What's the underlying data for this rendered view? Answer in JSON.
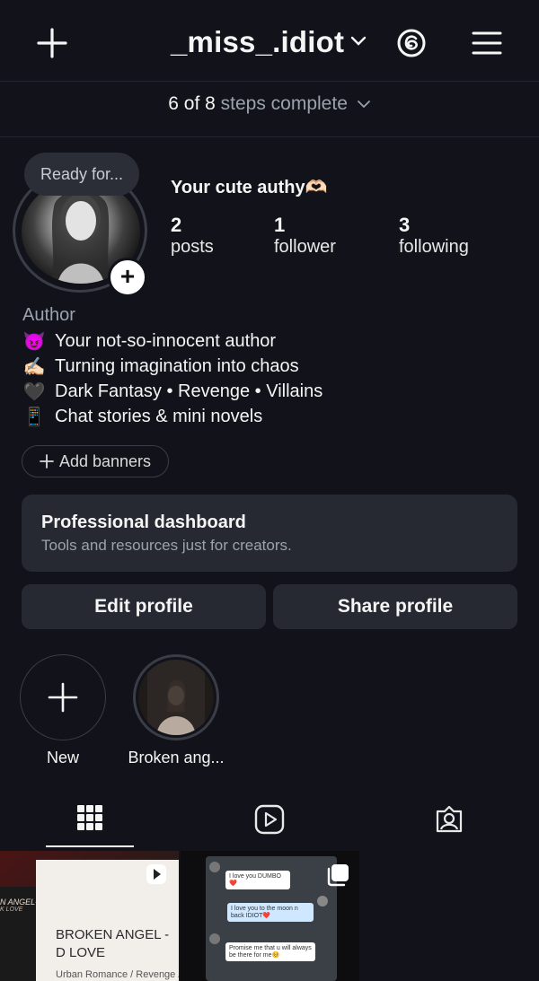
{
  "header": {
    "username": "_miss_.idiot",
    "new_post_icon": "plus-icon",
    "threads_icon": "threads-icon",
    "menu_icon": "hamburger-menu-icon"
  },
  "steps": {
    "done": "6 of 8",
    "rest": "steps complete"
  },
  "profile": {
    "note": "Ready for...",
    "display_name": "Your cute authy🫶🏻",
    "stats": [
      {
        "value": "2",
        "label": "posts"
      },
      {
        "value": "1",
        "label": "follower"
      },
      {
        "value": "3",
        "label": "following"
      }
    ]
  },
  "bio": {
    "category": "Author",
    "lines": [
      {
        "emoji": "😈",
        "text": "Your not-so-innocent author"
      },
      {
        "emoji": "✍🏻",
        "text": "Turning imagination into chaos"
      },
      {
        "emoji": "🖤",
        "text": "Dark Fantasy • Revenge • Villains"
      },
      {
        "emoji": "📱",
        "text": "Chat stories & mini novels"
      }
    ]
  },
  "add_banners_label": "Add banners",
  "dashboard": {
    "title": "Professional dashboard",
    "subtitle": "Tools and resources just for creators."
  },
  "buttons": {
    "edit": "Edit profile",
    "share": "Share profile"
  },
  "highlights": [
    {
      "label": "New"
    },
    {
      "label": "Broken ang..."
    }
  ],
  "tabs": [
    "grid-icon",
    "reels-icon",
    "tagged-icon"
  ],
  "posts": {
    "post1": {
      "title": "BROKEN ANGEL - D LOVE",
      "subtitle": "Urban Romance / Revenge /",
      "cover_text_1": "N ANGEL-",
      "cover_text_2": "K LOVE"
    },
    "post2": {
      "messages": [
        "I love you DUMBO❤️",
        "I love you to the moon n back IDIOT❤️",
        "Promise me that u will always be there for me🥺"
      ]
    }
  },
  "colors": {
    "background": "#12131a",
    "card": "#262932",
    "muted_text": "#9aa3ad"
  }
}
